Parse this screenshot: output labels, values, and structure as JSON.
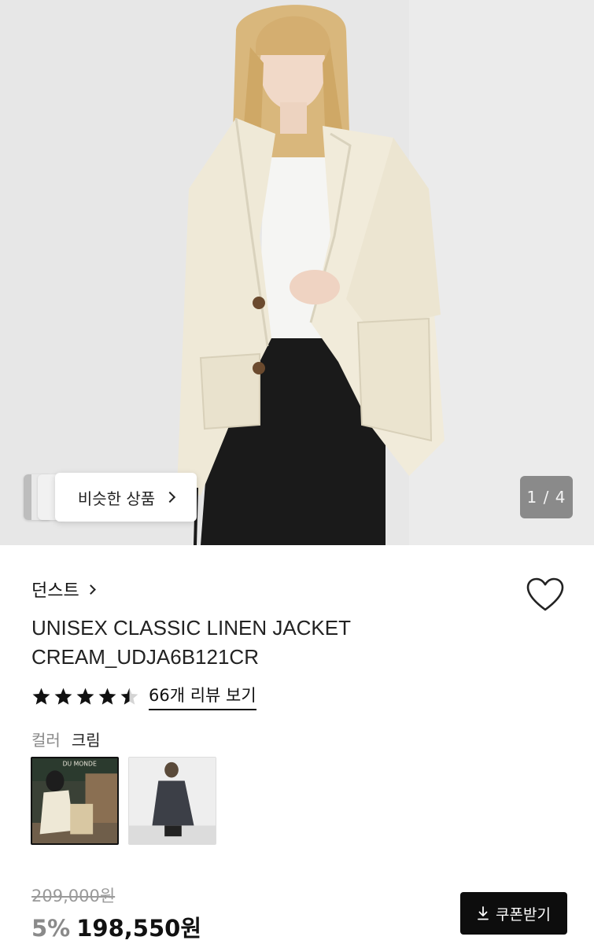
{
  "hero": {
    "similar_button_label": "비슷한 상품",
    "image_counter": "1 / 4"
  },
  "product": {
    "brand": "던스트",
    "title_line1": "UNISEX CLASSIC LINEN JACKET",
    "title_line2": "CREAM_UDJA6B121CR",
    "rating_stars": 4.5,
    "reviews_link": "66개 리뷰 보기",
    "color_label": "컬러",
    "color_value": "크림",
    "swatches": [
      {
        "name": "cream",
        "selected": true,
        "sign_text": "DU MONDE"
      },
      {
        "name": "charcoal",
        "selected": false
      }
    ]
  },
  "pricing": {
    "original_price": "209,000원",
    "discount": "5%",
    "sale_price": "198,550원",
    "coupon_button": "쿠폰받기"
  },
  "icons": {
    "heart": "heart-outline-icon",
    "download": "download-icon",
    "chevron": "chevron-right-icon",
    "star": "star-icon"
  },
  "colors": {
    "accent_dark": "#0d0d0d",
    "muted_text": "#9a9a9a",
    "discount_text": "#8a8a8a"
  }
}
